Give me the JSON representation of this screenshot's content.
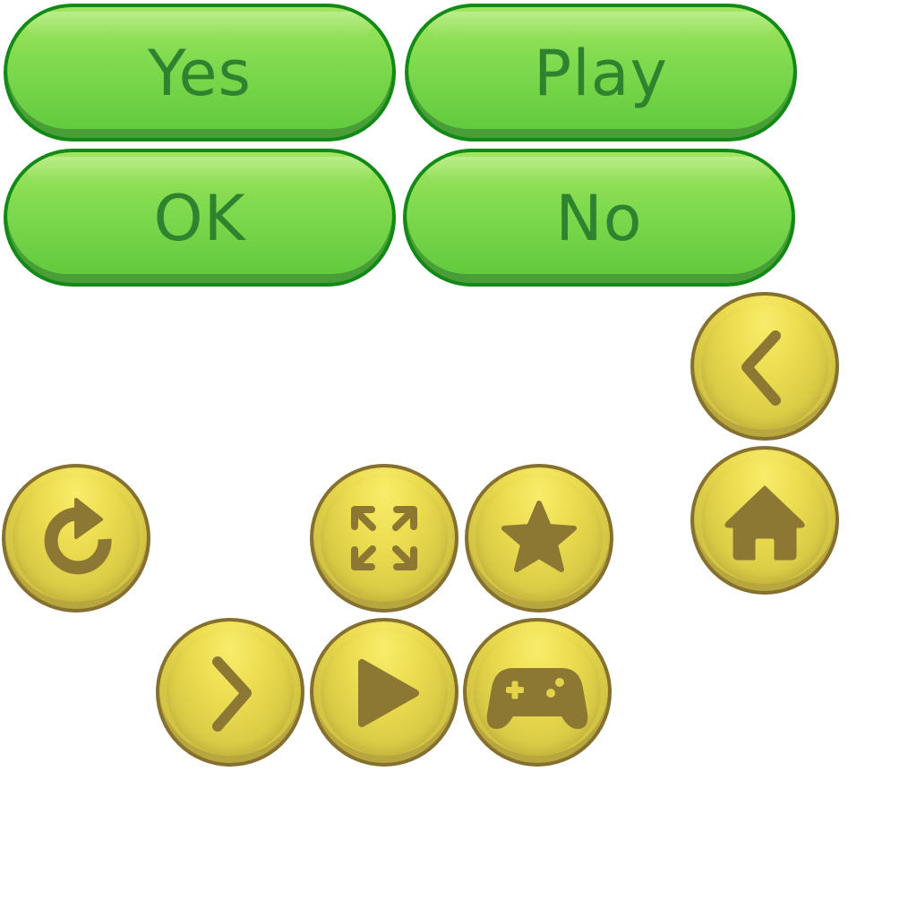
{
  "buttons": {
    "yes": "Yes",
    "play": "Play",
    "ok": "OK",
    "no": "No"
  },
  "icons": {
    "back": "chevron-left-icon",
    "home": "home-icon",
    "restart": "restart-icon",
    "fullscreen": "fullscreen-icon",
    "star": "star-icon",
    "next": "chevron-right-icon",
    "play": "play-icon",
    "gamepad": "gamepad-icon"
  },
  "colors": {
    "pill_fill": "#83db50",
    "pill_border": "#138a16",
    "pill_text": "#2f822e",
    "coin_fill": "#ecdc50",
    "coin_border": "#85702f",
    "icon": "#8c7833"
  }
}
